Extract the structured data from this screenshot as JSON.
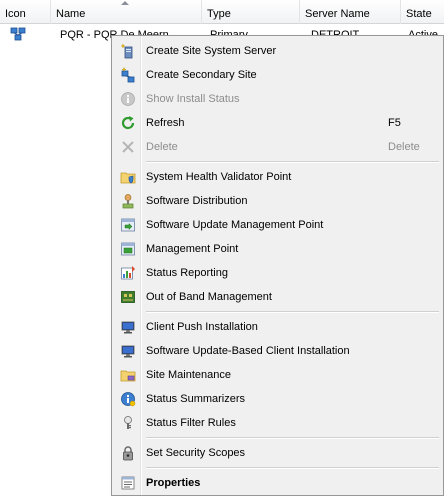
{
  "columns": {
    "icon": "Icon",
    "name": "Name",
    "type": "Type",
    "server": "Server Name",
    "state": "State"
  },
  "row": {
    "icon": "site-icon",
    "name": "PQR - PQR De Meern",
    "type": "Primary",
    "server": "DETROIT",
    "state": "Active"
  },
  "menu": {
    "create_site_system_server": "Create Site System Server",
    "create_secondary_site": "Create Secondary Site",
    "show_install_status": "Show Install Status",
    "refresh": "Refresh",
    "refresh_shortcut": "F5",
    "delete": "Delete",
    "delete_shortcut": "Delete",
    "system_health_validator_point": "System Health Validator Point",
    "software_distribution": "Software Distribution",
    "software_update_management_point": "Software Update Management Point",
    "management_point": "Management Point",
    "status_reporting": "Status Reporting",
    "out_of_band_management": "Out of Band Management",
    "client_push_installation": "Client Push Installation",
    "software_update_based_client_installation": "Software Update-Based Client Installation",
    "site_maintenance": "Site Maintenance",
    "status_summarizers": "Status Summarizers",
    "status_filter_rules": "Status Filter Rules",
    "set_security_scopes": "Set Security Scopes",
    "properties": "Properties"
  },
  "colors": {
    "menu_background": "#f0f0f0",
    "menu_border": "#979797",
    "disabled_text": "#8d8d8d"
  }
}
